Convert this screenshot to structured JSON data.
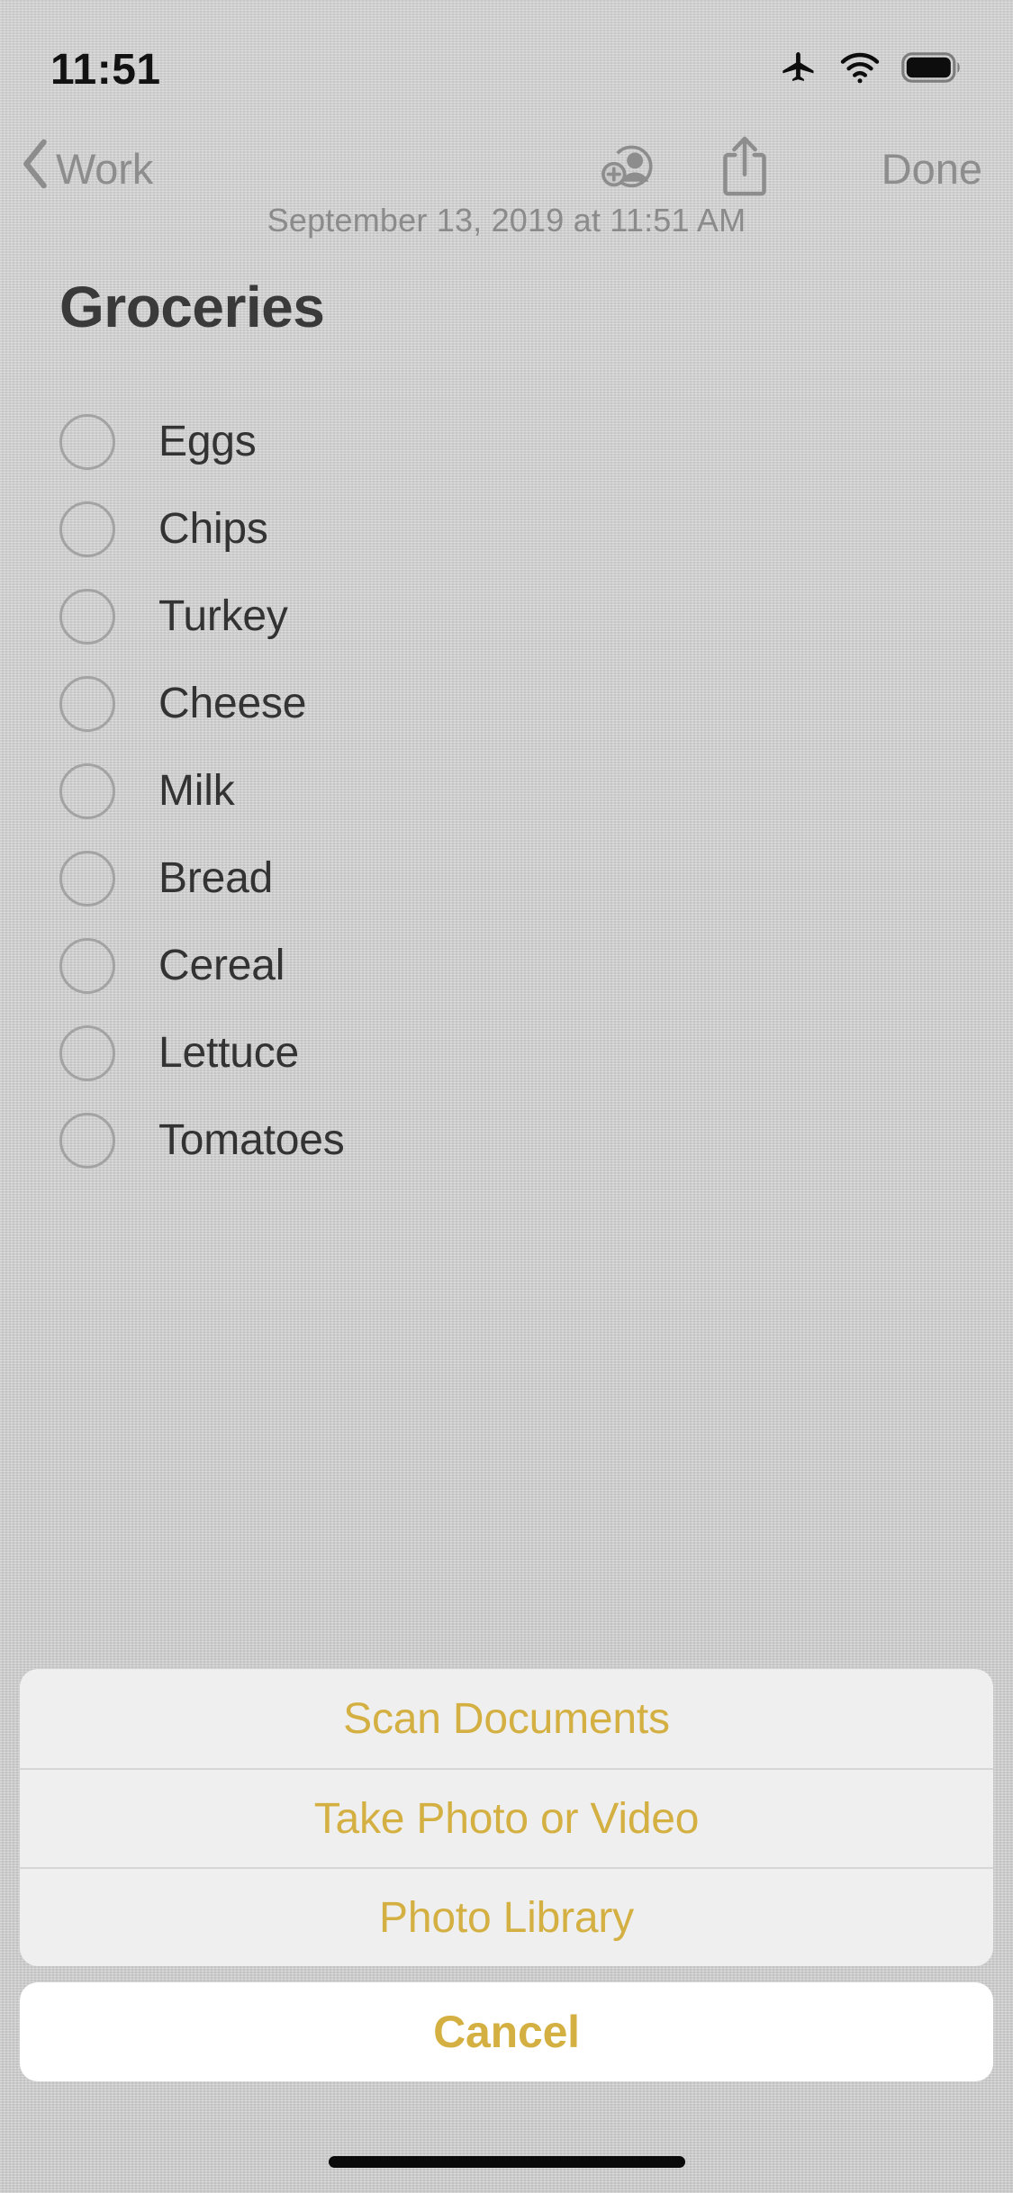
{
  "status_bar": {
    "time": "11:51",
    "icons": [
      "airplane-mode-icon",
      "wifi-icon",
      "battery-icon"
    ]
  },
  "nav_bar": {
    "back_label": "Work",
    "back_icon": "chevron-left-icon",
    "add_person_icon": "add-person-icon",
    "share_icon": "share-icon",
    "done_label": "Done"
  },
  "note": {
    "date": "September 13, 2019 at 11:51 AM",
    "title": "Groceries",
    "checklist": [
      {
        "label": "Eggs",
        "checked": false
      },
      {
        "label": "Chips",
        "checked": false
      },
      {
        "label": "Turkey",
        "checked": false
      },
      {
        "label": "Cheese",
        "checked": false
      },
      {
        "label": "Milk",
        "checked": false
      },
      {
        "label": "Bread",
        "checked": false
      },
      {
        "label": "Cereal",
        "checked": false
      },
      {
        "label": "Lettuce",
        "checked": false
      },
      {
        "label": "Tomatoes",
        "checked": false
      }
    ]
  },
  "action_sheet": {
    "options": [
      {
        "label": "Scan Documents"
      },
      {
        "label": "Take Photo or Video"
      },
      {
        "label": "Photo Library"
      }
    ],
    "cancel_label": "Cancel"
  },
  "colors": {
    "accent": "#d4b042",
    "background": "#c9c9c9",
    "sheet": "#efefef",
    "cancel_sheet": "#ffffff",
    "nav_tint": "#8d8d8d",
    "title_text": "#3a3a3a",
    "body_text": "#333333"
  }
}
